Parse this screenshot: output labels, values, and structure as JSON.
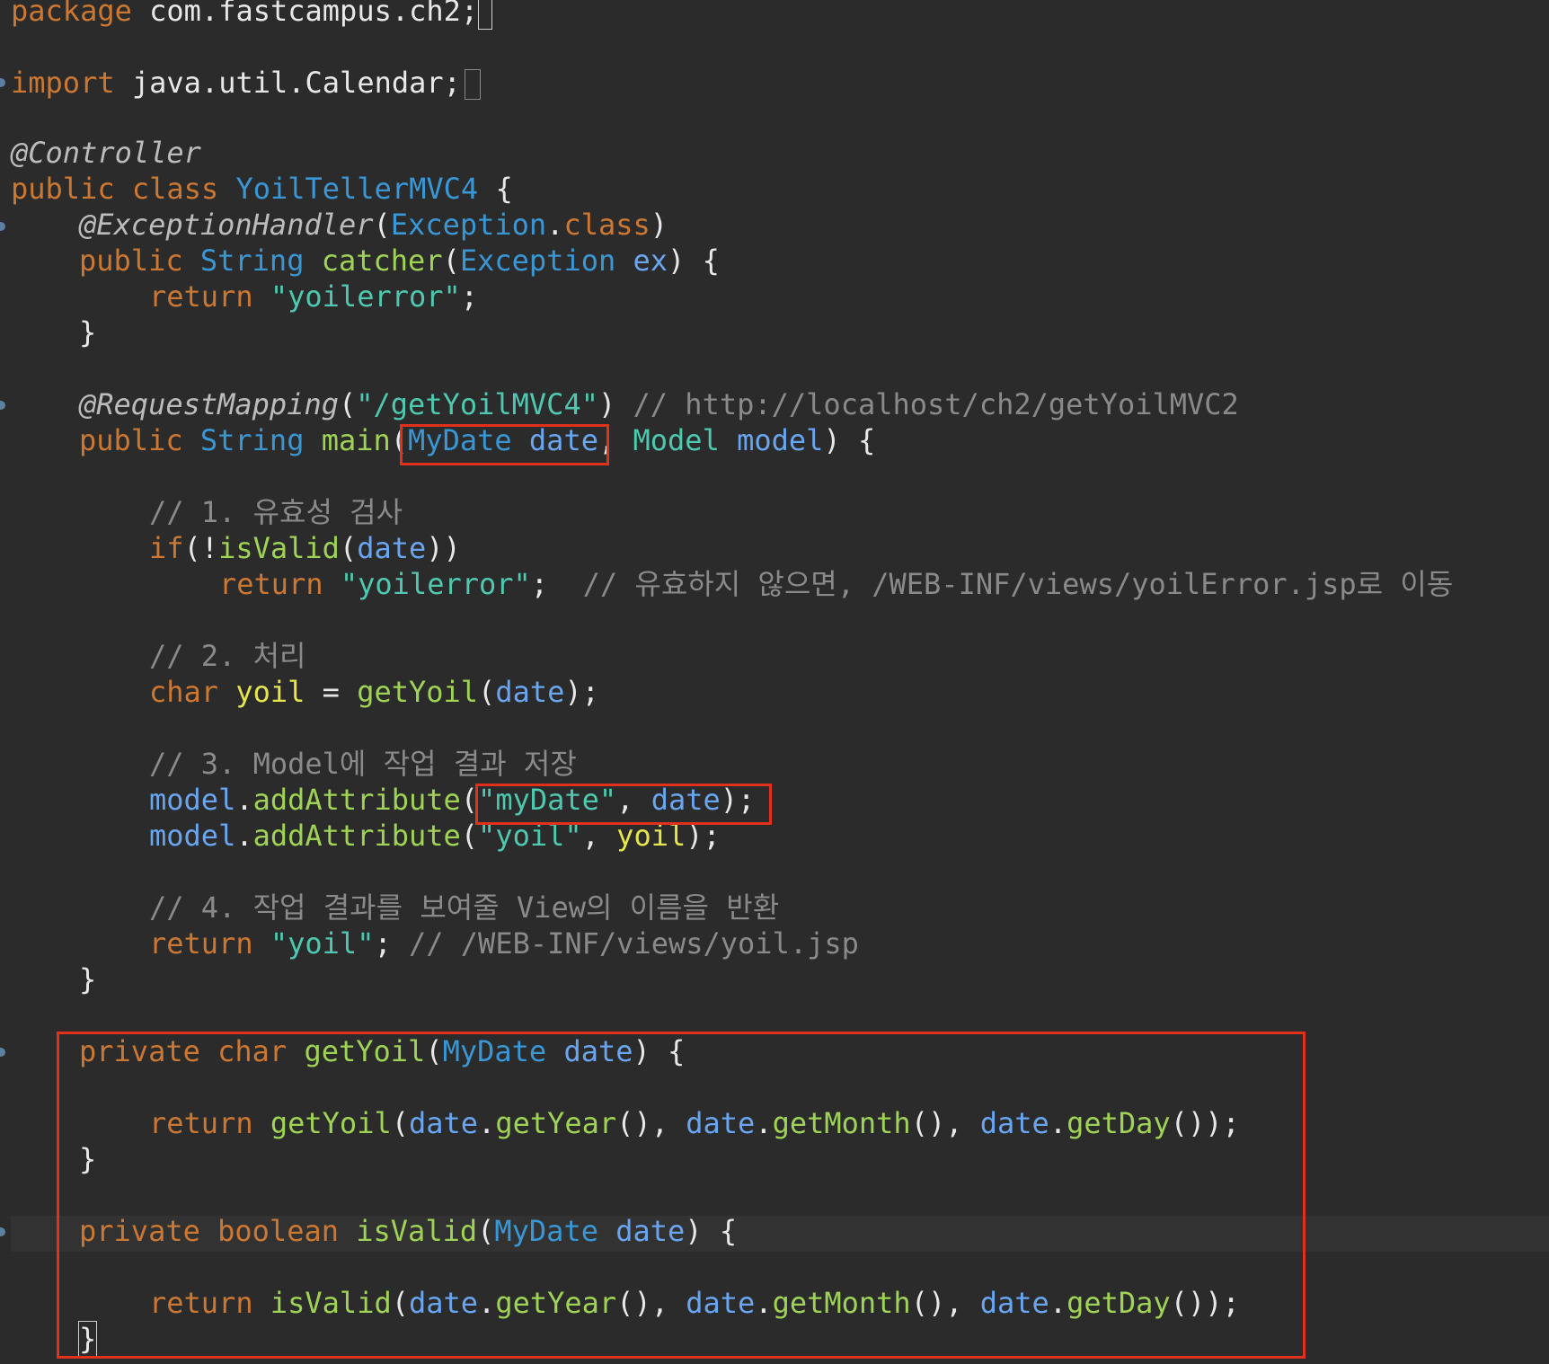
{
  "editor": {
    "file_language": "java",
    "lines": {
      "package_kw": "package",
      "package_name": " com.fastcampus.ch2;",
      "import_kw": "import",
      "import_name": " java.util.Calendar;",
      "controller_ann": "@Controller",
      "class_decl_kw": "public class ",
      "class_name": "YoilTellerMVC4",
      "class_brace": " {",
      "exhandler_ann": "@ExceptionHandler",
      "exhandler_open": "(",
      "exhandler_type": "Exception",
      "exhandler_dot": ".",
      "exhandler_class": "class",
      "exhandler_close": ")",
      "catcher_public": "public ",
      "catcher_string": "String ",
      "catcher_name": "catcher",
      "catcher_open": "(",
      "catcher_param_type": "Exception ",
      "catcher_param": "ex",
      "catcher_close": ") {",
      "catcher_return_kw": "return ",
      "catcher_return_str": "\"yoilerror\"",
      "catcher_semi": ";",
      "close_brace": "}",
      "reqmap_ann": "@RequestMapping",
      "reqmap_open": "(",
      "reqmap_str": "\"/getYoilMVC4\"",
      "reqmap_close": ") ",
      "reqmap_comment": "// http://localhost/ch2/getYoilMVC2",
      "main_public": "public ",
      "main_string": "String ",
      "main_name": "main",
      "main_open": "(",
      "main_p1_type": "MyDate ",
      "main_p1": "date",
      "main_comma": ", ",
      "main_p2_type": "Model ",
      "main_p2": "model",
      "main_close": ") {",
      "c1": "// 1. 유효성 검사",
      "if_kw": "if",
      "if_open": "(!",
      "if_fn": "isValid",
      "if_paren": "(",
      "if_var": "date",
      "if_close": "))",
      "ret2_kw": "return ",
      "ret2_str": "\"yoilerror\"",
      "ret2_semi": ";  ",
      "ret2_comment": "// 유효하지 않으면, /WEB-INF/views/yoilError.jsp로 이동",
      "c2": "// 2. 처리",
      "char_kw": "char ",
      "yoil_var": "yoil",
      "assign": " = ",
      "getyoil_fn": "getYoil",
      "gy_open": "(",
      "gy_var": "date",
      "gy_close": ");",
      "c3": "// 3. Model에 작업 결과 저장",
      "model1": "model",
      "dot": ".",
      "addattr": "addAttribute",
      "aa_open": "(",
      "aa1_str": "\"myDate\"",
      "aa1_comma": ", ",
      "aa1_var": "date",
      "aa_close": ");",
      "aa2_str": "\"yoil\"",
      "aa2_var": "yoil",
      "c4": "// 4. 작업 결과를 보여줄 View의 이름을 반환",
      "ret3_kw": "return ",
      "ret3_str": "\"yoil\"",
      "ret3_semi": "; ",
      "ret3_comment": "// /WEB-INF/views/yoil.jsp",
      "priv_kw": "private ",
      "priv_char": "char ",
      "priv_getyoil": "getYoil",
      "priv_open": "(",
      "priv_type": "MyDate ",
      "priv_param": "date",
      "priv_close": ") {",
      "ret4_kw": "return ",
      "ret4_fn": "getYoil",
      "ret4_open": "(",
      "date_var": "date",
      "getyear": "getYear",
      "empty_args": "()",
      "comma_sp": ", ",
      "getmonth": "getMonth",
      "getday": "getDay",
      "ret4_close": "());",
      "priv_boolean": "boolean ",
      "priv_isvalid": "isValid",
      "ret5_fn": "isValid"
    }
  },
  "colors": {
    "background": "#2b2b2b",
    "highlight_box": "#e1311d"
  }
}
